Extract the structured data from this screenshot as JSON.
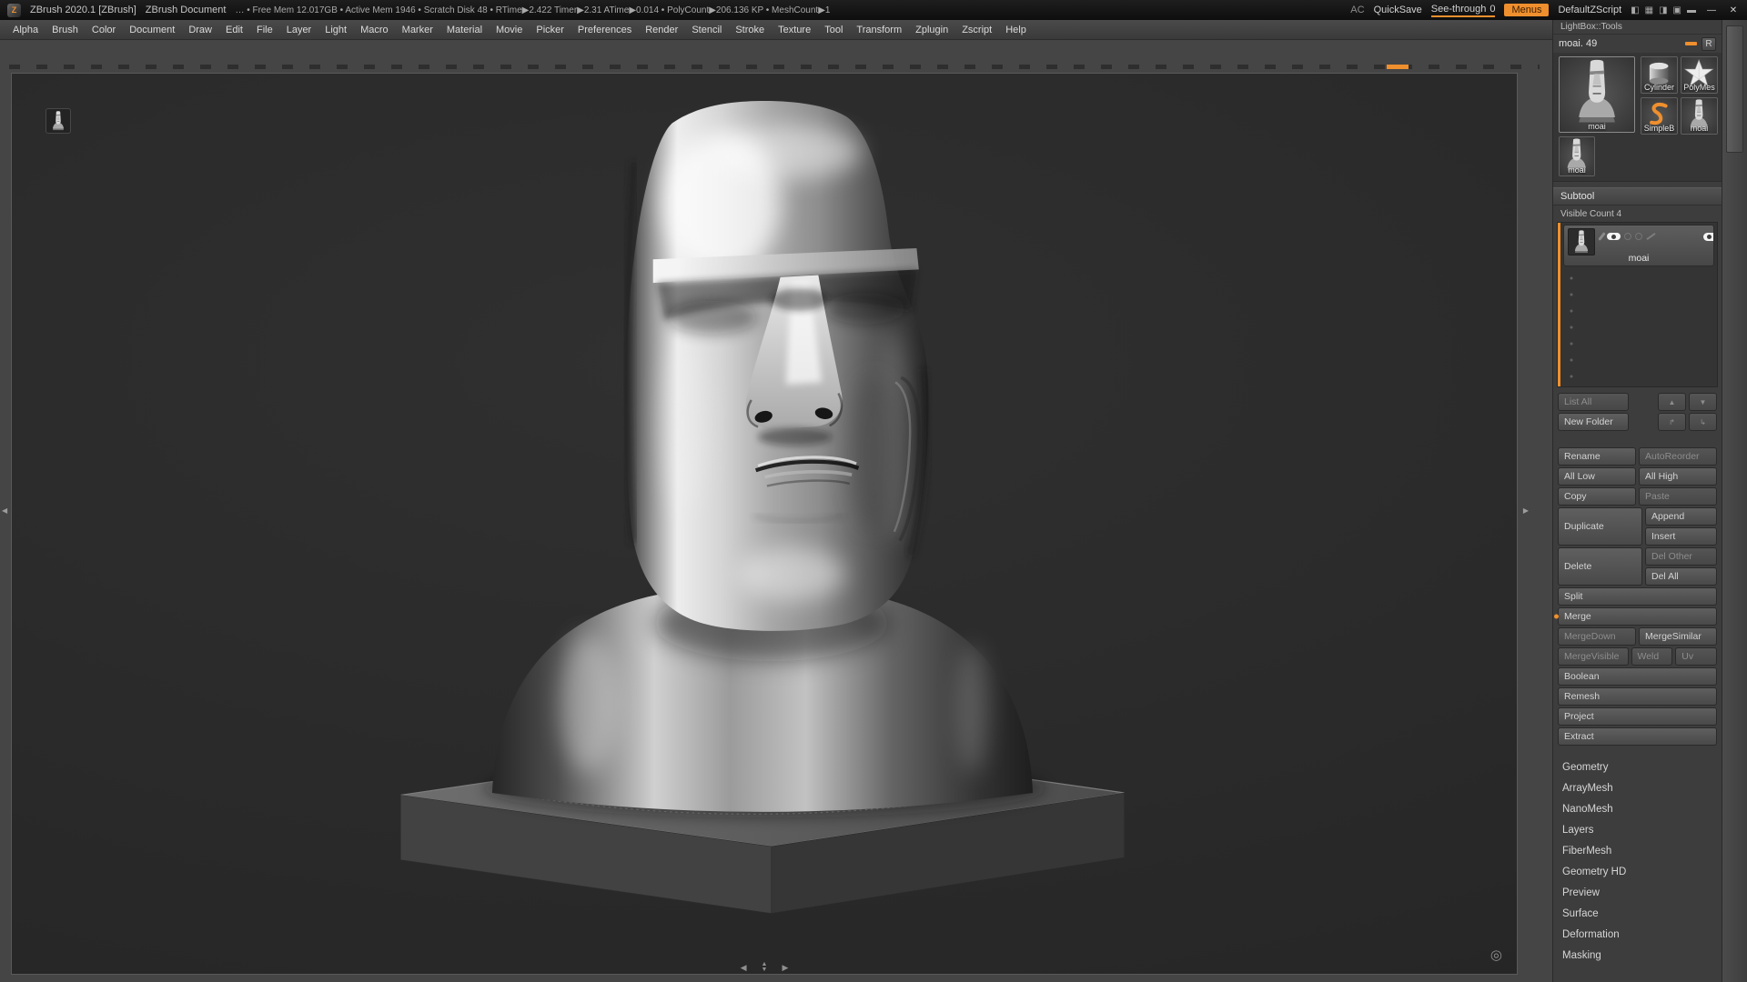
{
  "titlebar": {
    "app_title": "ZBrush 2020.1 [ZBrush]",
    "document_title": "ZBrush Document",
    "stats": "… • Free Mem 12.017GB • Active Mem 1946 • Scratch Disk 48 • RTime▶2.422 Timer▶2.31 ATime▶0.014 • PolyCount▶206.136 KP • MeshCount▶1",
    "ac": "AC",
    "quicksave": "QuickSave",
    "seethrough_label": "See-through",
    "seethrough_value": "0",
    "menus": "Menus",
    "default_zscript": "DefaultZScript"
  },
  "menubar": {
    "items": [
      "Alpha",
      "Brush",
      "Color",
      "Document",
      "Draw",
      "Edit",
      "File",
      "Layer",
      "Light",
      "Macro",
      "Marker",
      "Material",
      "Movie",
      "Picker",
      "Preferences",
      "Render",
      "Stencil",
      "Stroke",
      "Texture",
      "Tool",
      "Transform",
      "Zplugin",
      "Zscript",
      "Help"
    ]
  },
  "tool_panel": {
    "tray_header": "LightBox::Tools",
    "active_tool": "moai. 49",
    "restore": "R",
    "thumbnails": [
      {
        "label": "moai"
      },
      {
        "label": "Cylinder"
      },
      {
        "label": "PolyMes"
      },
      {
        "label": "SimpleB"
      },
      {
        "label": "moai"
      },
      {
        "label": "moai"
      }
    ],
    "subtool": {
      "header": "Subtool",
      "visible_count": "Visible Count 4",
      "item_name": "moai",
      "buttons": {
        "list_all": "List All",
        "new_folder": "New Folder",
        "rename": "Rename",
        "autoreorder": "AutoReorder",
        "all_low": "All Low",
        "all_high": "All High",
        "copy": "Copy",
        "paste": "Paste",
        "duplicate": "Duplicate",
        "append": "Append",
        "insert": "Insert",
        "delete": "Delete",
        "del_other": "Del Other",
        "del_all": "Del All",
        "split": "Split",
        "merge": "Merge",
        "merge_down": "MergeDown",
        "merge_similar": "MergeSimilar",
        "merge_visible": "MergeVisible",
        "weld": "Weld",
        "uv": "Uv",
        "boolean": "Boolean",
        "remesh": "Remesh",
        "project": "Project",
        "extract": "Extract"
      }
    },
    "sections": [
      "Geometry",
      "ArrayMesh",
      "NanoMesh",
      "Layers",
      "FiberMesh",
      "Geometry HD",
      "Preview",
      "Surface",
      "Deformation",
      "Masking"
    ]
  },
  "icons": {
    "logo": "Z",
    "up_arrow": "▲",
    "down_arrow": "▼",
    "folder_out": "↱",
    "folder_in": "↳",
    "tray_left": "◀",
    "tray_right": "▶",
    "scroll_left": "◀",
    "scroll_up": "▲",
    "scroll_down": "▼",
    "scroll_right": "▶",
    "minimize": "—",
    "close": "✕",
    "layout_left": "◧",
    "layout_grid": "▦",
    "layout_right": "◨",
    "layout_window": "▣",
    "layout_bar": "▬",
    "pivot": "◎"
  },
  "colors": {
    "accent_orange": "#ef8f2e"
  }
}
